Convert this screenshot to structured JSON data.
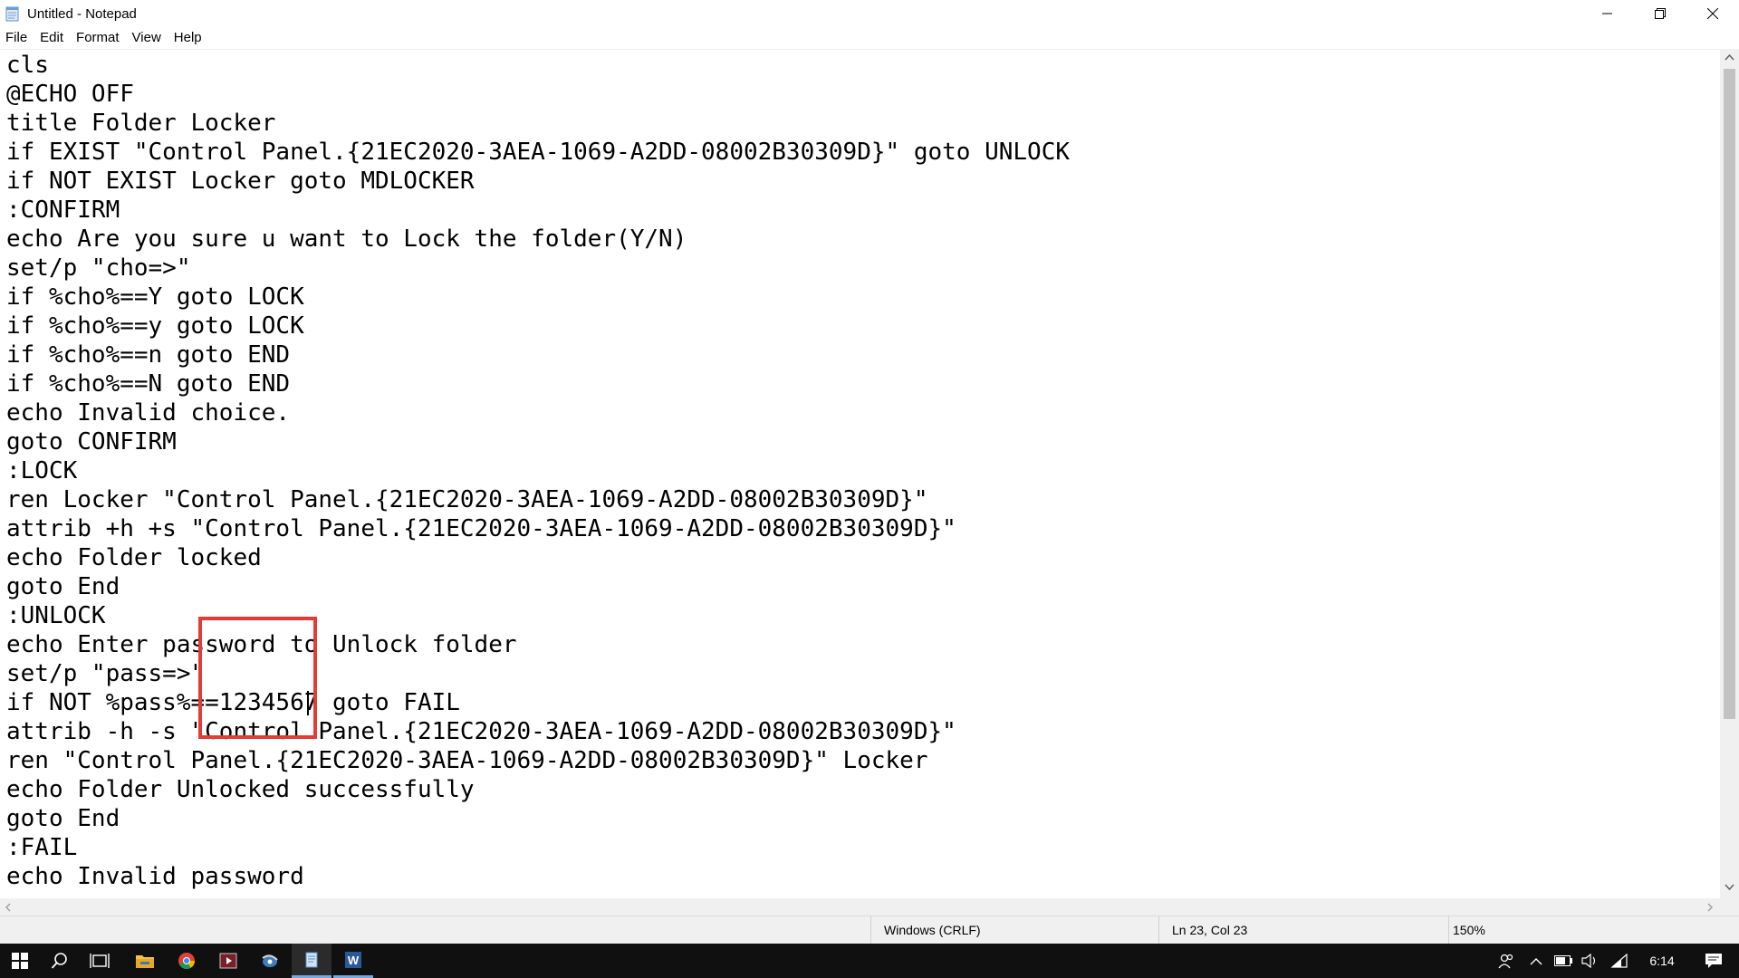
{
  "window": {
    "title": "Untitled - Notepad"
  },
  "menu": {
    "items": [
      "File",
      "Edit",
      "Format",
      "View",
      "Help"
    ]
  },
  "editor": {
    "lines": [
      "cls",
      "@ECHO OFF",
      "title Folder Locker",
      "if EXIST \"Control Panel.{21EC2020-3AEA-1069-A2DD-08002B30309D}\" goto UNLOCK",
      "if NOT EXIST Locker goto MDLOCKER",
      ":CONFIRM",
      "echo Are you sure u want to Lock the folder(Y/N)",
      "set/p \"cho=>\"",
      "if %cho%==Y goto LOCK",
      "if %cho%==y goto LOCK",
      "if %cho%==n goto END",
      "if %cho%==N goto END",
      "echo Invalid choice.",
      "goto CONFIRM",
      ":LOCK",
      "ren Locker \"Control Panel.{21EC2020-3AEA-1069-A2DD-08002B30309D}\"",
      "attrib +h +s \"Control Panel.{21EC2020-3AEA-1069-A2DD-08002B30309D}\"",
      "echo Folder locked",
      "goto End",
      ":UNLOCK",
      "echo Enter password to Unlock folder",
      "set/p \"pass=>\"",
      "if NOT %pass%==1234567 goto FAIL",
      "attrib -h -s \"Control Panel.{21EC2020-3AEA-1069-A2DD-08002B30309D}\"",
      "ren \"Control Panel.{21EC2020-3AEA-1069-A2DD-08002B30309D}\" Locker",
      "echo Folder Unlocked successfully",
      "goto End",
      ":FAIL",
      "echo Invalid password"
    ],
    "highlight_color": "#e53b36"
  },
  "status": {
    "line_ending": "Windows (CRLF)",
    "position": "Ln 23, Col 23",
    "zoom": "150%"
  },
  "taskbar": {
    "clock": "6:14",
    "icons": [
      "windows-start-icon",
      "search-icon",
      "task-view-icon",
      "file-explorer-icon",
      "chrome-icon",
      "media-player-icon",
      "app-icon",
      "notepad-icon",
      "word-icon"
    ],
    "tray_icons": [
      "people-icon",
      "chevron-up-icon",
      "battery-icon",
      "volume-icon",
      "wifi-icon",
      "notification-icon"
    ]
  }
}
